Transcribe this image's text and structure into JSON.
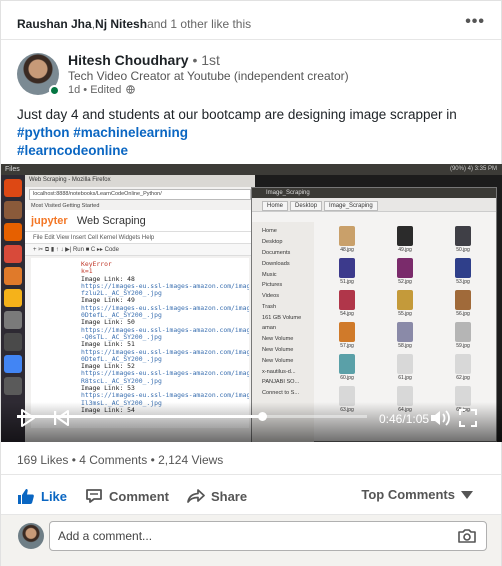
{
  "social": {
    "actor1": "Raushan Jha",
    "sep": ", ",
    "actor2": "Nj Nitesh",
    "rest": " and 1 other like this",
    "more_icon": "more-horizontal-icon"
  },
  "author": {
    "name": "Hitesh Choudhary",
    "degree": " • 1st",
    "headline": "Tech Video Creator at Youtube (independent creator)",
    "time": "1d • Edited"
  },
  "post": {
    "text": "Just day 4 and students at our bootcamp are designing image scrapper in",
    "hashtags_line1": "#python #machinelearning",
    "hashtags_line2": "#learncodeonline"
  },
  "video": {
    "topbar_title": "Files",
    "topbar_right": "(90%) 4) 3:35 PM",
    "browser_title": "Web Scraping - Mozilla Firefox",
    "url": "localhost:8888/notebooks/LearnCodeOnline_Python/",
    "bookmarks": "Most Visited   Getting Started",
    "jupyter_logo": "jupyter",
    "notebook_title": "Web Scraping",
    "menu": "File   Edit   View   Insert   Cell   Kernel   Widgets   Help",
    "tools": "+   ✂   ⧉   ▮   ↑   ↓   ▶| Run   ■   C   ▸▸   Code",
    "code_lines": [
      {
        "cls": "err",
        "t": "KeyError"
      },
      {
        "cls": "err",
        "t": "k=1"
      },
      {
        "cls": "lk",
        "t": "Image Link: 48"
      },
      {
        "cls": "url",
        "t": "https://images-eu.ssl-images-amazon.com/imag"
      },
      {
        "cls": "url",
        "t": "fzlu2L._AC_SY200_.jpg"
      },
      {
        "cls": "lk",
        "t": "Image Link: 49"
      },
      {
        "cls": "url",
        "t": "https://images-eu.ssl-images-amazon.com/imag"
      },
      {
        "cls": "url",
        "t": "0DtefL._AC_SY200_.jpg"
      },
      {
        "cls": "lk",
        "t": "Image Link: 50"
      },
      {
        "cls": "url",
        "t": "https://images-eu.ssl-images-amazon.com/imag"
      },
      {
        "cls": "url",
        "t": "-Q0sTL._AC_SY200_.jpg"
      },
      {
        "cls": "lk",
        "t": "Image Link: 51"
      },
      {
        "cls": "url",
        "t": "https://images-eu.ssl-images-amazon.com/imag"
      },
      {
        "cls": "url",
        "t": "0DtefL._AC_SY200_.jpg"
      },
      {
        "cls": "lk",
        "t": "Image Link: 52"
      },
      {
        "cls": "url",
        "t": "https://images-eu.ssl-images-amazon.com/imag"
      },
      {
        "cls": "url",
        "t": "R8tscL._AC_SY200_.jpg"
      },
      {
        "cls": "lk",
        "t": "Image Link: 53"
      },
      {
        "cls": "url",
        "t": "https://images-eu.ssl-images-amazon.com/imag"
      },
      {
        "cls": "url",
        "t": "Il3msL._AC_SY200_.jpg"
      },
      {
        "cls": "lk",
        "t": "Image Link: 54"
      }
    ],
    "files_title": "Image_Scraping",
    "path_buttons": [
      "Home",
      "Desktop",
      "Image_Scraping"
    ],
    "sidebar": [
      "Home",
      "Desktop",
      "Documents",
      "Downloads",
      "Music",
      "Pictures",
      "Videos",
      "Trash",
      "161 GB Volume",
      "aman",
      "New Volume",
      "New Volume",
      "New Volume",
      "x-nautilus-d...",
      "PANJABI SO...",
      "Connect to S..."
    ],
    "files": [
      {
        "name": "48.jpg",
        "color": "#c9a06a"
      },
      {
        "name": "49.jpg",
        "color": "#2b2b2b"
      },
      {
        "name": "50.jpg",
        "color": "#3f3f46"
      },
      {
        "name": "51.jpg",
        "color": "#3c3a8c"
      },
      {
        "name": "52.jpg",
        "color": "#7a2b6b"
      },
      {
        "name": "53.jpg",
        "color": "#2f3f8a"
      },
      {
        "name": "54.jpg",
        "color": "#b0364a"
      },
      {
        "name": "55.jpg",
        "color": "#c49a3a"
      },
      {
        "name": "56.jpg",
        "color": "#a06a3a"
      },
      {
        "name": "57.jpg",
        "color": "#d07a2a"
      },
      {
        "name": "58.jpg",
        "color": "#8a8aa8"
      },
      {
        "name": "59.jpg",
        "color": "#b5b5b5"
      },
      {
        "name": "60.jpg",
        "color": "#5aa0a8"
      },
      {
        "name": "61.jpg",
        "color": "#d8d8d8"
      },
      {
        "name": "62.jpg",
        "color": "#d8d8d8"
      },
      {
        "name": "63.jpg",
        "color": "#d8d8d8"
      },
      {
        "name": "64.jpg",
        "color": "#d8d8d8"
      },
      {
        "name": "65.jpg",
        "color": "#d8d8d8"
      }
    ],
    "time_readout": "0:46/1:05",
    "progress_fraction": 0.7
  },
  "stats": {
    "text": "169 Likes • 4 Comments • 2,124 Views"
  },
  "actions": {
    "like": "Like",
    "comment": "Comment",
    "share": "Share",
    "sort": "Top Comments"
  },
  "comment": {
    "placeholder": "Add a comment..."
  },
  "colors": {
    "brand_blue": "#0a66c2",
    "online_green": "#057642"
  }
}
